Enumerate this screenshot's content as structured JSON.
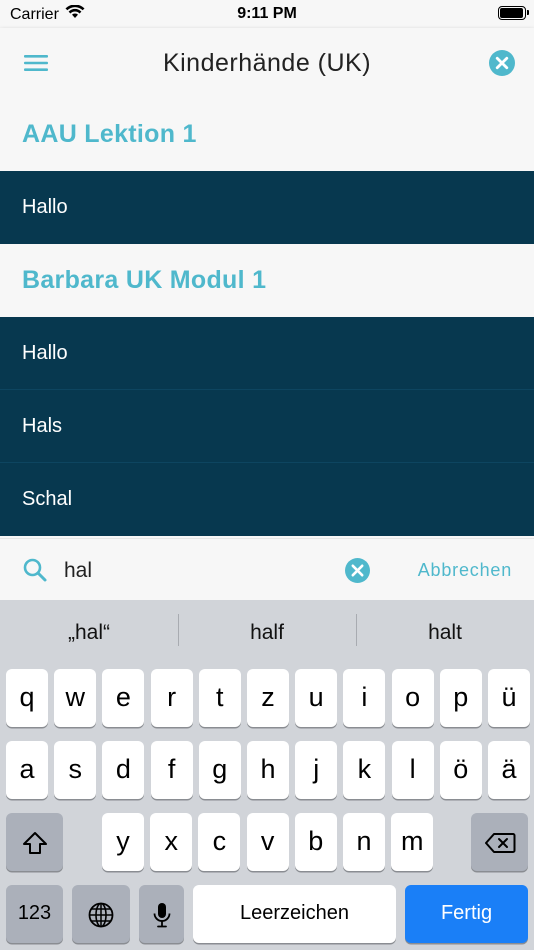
{
  "status": {
    "carrier": "Carrier",
    "time": "9:11 PM",
    "battery_level": 0.95
  },
  "nav": {
    "title": "Kinderhände (UK)",
    "menu_icon": "hamburger-icon",
    "close_icon": "close-circle-icon"
  },
  "sections": [
    {
      "title": "AAU Lektion 1",
      "items": [
        "Hallo"
      ]
    },
    {
      "title": "Barbara UK Modul 1",
      "items": [
        "Hallo",
        "Hals",
        "Schal"
      ]
    }
  ],
  "search": {
    "value": "hal",
    "placeholder": "",
    "cancel_label": "Abbrechen"
  },
  "keyboard": {
    "suggestions": [
      "„hal“",
      "half",
      "halt"
    ],
    "row1": [
      "q",
      "w",
      "e",
      "r",
      "t",
      "z",
      "u",
      "i",
      "o",
      "p",
      "ü"
    ],
    "row2": [
      "a",
      "s",
      "d",
      "f",
      "g",
      "h",
      "j",
      "k",
      "l",
      "ö",
      "ä"
    ],
    "row3": [
      "y",
      "x",
      "c",
      "v",
      "b",
      "n",
      "m"
    ],
    "numbers_label": "123",
    "space_label": "Leerzeichen",
    "return_label": "Fertig"
  },
  "colors": {
    "accent": "#4fb8cc",
    "row_bg": "#07384f",
    "return_key": "#1a7ff7"
  }
}
